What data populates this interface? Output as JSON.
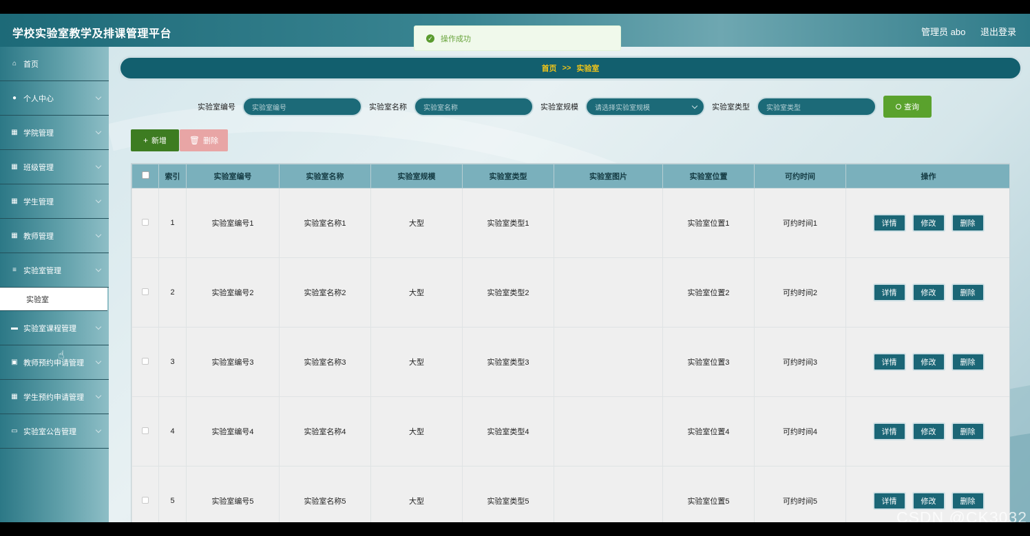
{
  "app": {
    "title": "学校实验室教学及排课管理平台"
  },
  "user": {
    "name": "管理员 abo",
    "logout": "退出登录"
  },
  "toast": {
    "message": "操作成功"
  },
  "sidebar": {
    "items": [
      {
        "label": "首页",
        "icon": "home-icon",
        "glyph": "⌂"
      },
      {
        "label": "个人中心",
        "icon": "user-icon",
        "glyph": "●"
      },
      {
        "label": "学院管理",
        "icon": "grid-icon",
        "glyph": "▦"
      },
      {
        "label": "班级管理",
        "icon": "grid-icon",
        "glyph": "▦"
      },
      {
        "label": "学生管理",
        "icon": "grid-icon",
        "glyph": "▦"
      },
      {
        "label": "教师管理",
        "icon": "grid-icon",
        "glyph": "▦"
      },
      {
        "label": "实验室管理",
        "icon": "list-icon",
        "glyph": "≡"
      },
      {
        "label": "实验室课程管理",
        "icon": "chat-icon",
        "glyph": "▬"
      },
      {
        "label": "教师预约申请管理",
        "icon": "clipboard-icon",
        "glyph": "▣"
      },
      {
        "label": "学生预约申请管理",
        "icon": "grid-icon",
        "glyph": "▦"
      },
      {
        "label": "实验室公告管理",
        "icon": "monitor-icon",
        "glyph": "▭"
      }
    ],
    "sub_item": "实验室"
  },
  "breadcrumb": {
    "home": "首页",
    "sep": ">>",
    "current": "实验室"
  },
  "search": {
    "f1_label": "实验室编号",
    "f1_placeholder": "实验室编号",
    "f2_label": "实验室名称",
    "f2_placeholder": "实验室名称",
    "f3_label": "实验室规模",
    "f3_placeholder": "请选择实验室规模",
    "f4_label": "实验室类型",
    "f4_placeholder": "实验室类型",
    "query": "查询"
  },
  "actions": {
    "add": "新增",
    "delete": "删除"
  },
  "table": {
    "headers": [
      "索引",
      "实验室编号",
      "实验室名称",
      "实验室规模",
      "实验室类型",
      "实验室图片",
      "实验室位置",
      "可约时间",
      "操作"
    ],
    "rows": [
      {
        "idx": "1",
        "code": "实验室编号1",
        "name": "实验室名称1",
        "scale": "大型",
        "type": "实验室类型1",
        "pic": "",
        "loc": "实验室位置1",
        "time": "可约时间1"
      },
      {
        "idx": "2",
        "code": "实验室编号2",
        "name": "实验室名称2",
        "scale": "大型",
        "type": "实验室类型2",
        "pic": "",
        "loc": "实验室位置2",
        "time": "可约时间2"
      },
      {
        "idx": "3",
        "code": "实验室编号3",
        "name": "实验室名称3",
        "scale": "大型",
        "type": "实验室类型3",
        "pic": "",
        "loc": "实验室位置3",
        "time": "可约时间3"
      },
      {
        "idx": "4",
        "code": "实验室编号4",
        "name": "实验室名称4",
        "scale": "大型",
        "type": "实验室类型4",
        "pic": "",
        "loc": "实验室位置4",
        "time": "可约时间4"
      },
      {
        "idx": "5",
        "code": "实验室编号5",
        "name": "实验室名称5",
        "scale": "大型",
        "type": "实验室类型5",
        "pic": "",
        "loc": "实验室位置5",
        "time": "可约时间5"
      }
    ],
    "ops": {
      "detail": "详情",
      "edit": "修改",
      "delete": "删除"
    }
  },
  "watermark": "CSDN @CK3032"
}
